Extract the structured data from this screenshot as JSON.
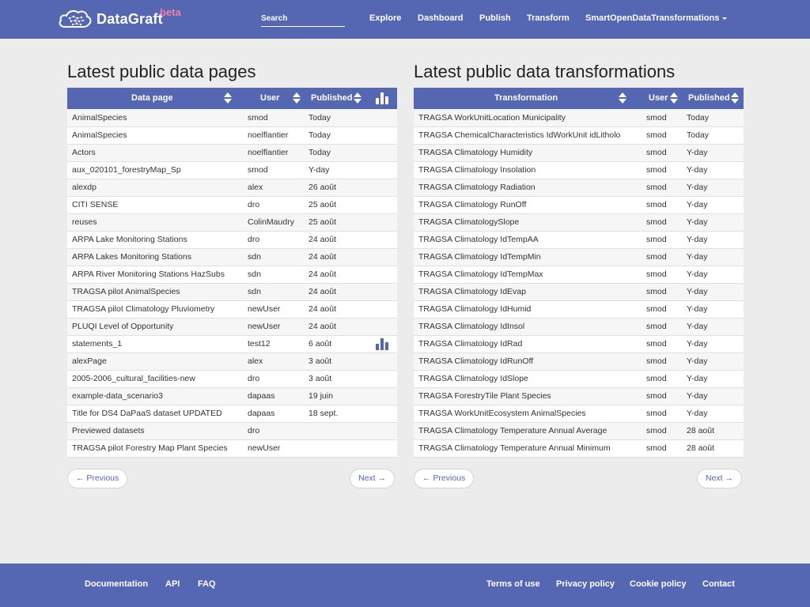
{
  "navbar": {
    "brand": "DataGraft",
    "beta": "beta",
    "search_placeholder": "Search",
    "items": [
      "Explore",
      "Dashboard",
      "Publish",
      "Transform",
      "SmartOpenDataTransformations"
    ]
  },
  "colors": {
    "primary": "#5566b2",
    "beta": "#f37fa8",
    "background": "#ececec"
  },
  "data_pages": {
    "title": "Latest public data pages",
    "columns": [
      "Data page",
      "User",
      "Published"
    ],
    "rows": [
      {
        "name": "AnimalSpecies",
        "user": "smod",
        "published": "Today",
        "chart": false
      },
      {
        "name": "AnimalSpecies",
        "user": "noelflantier",
        "published": "Today",
        "chart": false
      },
      {
        "name": "Actors",
        "user": "noelflantier",
        "published": "Today",
        "chart": false
      },
      {
        "name": "aux_020101_forestryMap_Sp",
        "user": "smod",
        "published": "Y-day",
        "chart": false
      },
      {
        "name": "alexdp",
        "user": "alex",
        "published": "26 août",
        "chart": false
      },
      {
        "name": "CITI SENSE",
        "user": "dro",
        "published": "25 août",
        "chart": false
      },
      {
        "name": "reuses",
        "user": "ColinMaudry",
        "published": "25 août",
        "chart": false
      },
      {
        "name": "ARPA Lake Monitoring Stations",
        "user": "dro",
        "published": "24 août",
        "chart": false
      },
      {
        "name": "ARPA Lakes Monitoring Stations",
        "user": "sdn",
        "published": "24 août",
        "chart": false
      },
      {
        "name": "ARPA River Monitoring Stations HazSubs",
        "user": "sdn",
        "published": "24 août",
        "chart": false
      },
      {
        "name": "TRAGSA pilot AnimalSpecies",
        "user": "sdn",
        "published": "24 août",
        "chart": false
      },
      {
        "name": "TRAGSA pilot Climatology Pluviometry",
        "user": "newUser",
        "published": "24 août",
        "chart": false
      },
      {
        "name": "PLUQI Level of Opportunity",
        "user": "newUser",
        "published": "24 août",
        "chart": false
      },
      {
        "name": "statements_1",
        "user": "test12",
        "published": "6 août",
        "chart": true
      },
      {
        "name": "alexPage",
        "user": "alex",
        "published": "3 août",
        "chart": false
      },
      {
        "name": "2005-2006_cultural_facilities-new",
        "user": "dro",
        "published": "3 août",
        "chart": false
      },
      {
        "name": "example-data_scenario3",
        "user": "dapaas",
        "published": "19 juin",
        "chart": false
      },
      {
        "name": "Title for DS4 DaPaaS dataset UPDATED",
        "user": "dapaas",
        "published": "18 sept.",
        "chart": false
      },
      {
        "name": "Previewed datasets",
        "user": "dro",
        "published": "",
        "chart": false
      },
      {
        "name": "TRAGSA pilot Forestry Map Plant Species",
        "user": "newUser",
        "published": "",
        "chart": false
      }
    ],
    "prev": "← Previous",
    "next": "Next →"
  },
  "transformations": {
    "title": "Latest public data transformations",
    "columns": [
      "Transformation",
      "User",
      "Published"
    ],
    "rows": [
      {
        "name": "TRAGSA WorkUnitLocation Municipality",
        "user": "smod",
        "published": "Today"
      },
      {
        "name": "TRAGSA ChemicalCharacteristics IdWorkUnit idLitholo",
        "user": "smod",
        "published": "Today"
      },
      {
        "name": "TRAGSA Climatology Humidity",
        "user": "smod",
        "published": "Y-day"
      },
      {
        "name": "TRAGSA Climatology Insolation",
        "user": "smod",
        "published": "Y-day"
      },
      {
        "name": "TRAGSA Climatology Radiation",
        "user": "smod",
        "published": "Y-day"
      },
      {
        "name": "TRAGSA Climatology RunOff",
        "user": "smod",
        "published": "Y-day"
      },
      {
        "name": "TRAGSA ClimatologySlope",
        "user": "smod",
        "published": "Y-day"
      },
      {
        "name": "TRAGSA Climatology IdTempAA",
        "user": "smod",
        "published": "Y-day"
      },
      {
        "name": "TRAGSA Climatology IdTempMin",
        "user": "smod",
        "published": "Y-day"
      },
      {
        "name": "TRAGSA Climatology IdTempMax",
        "user": "smod",
        "published": "Y-day"
      },
      {
        "name": "TRAGSA Climatology IdEvap",
        "user": "smod",
        "published": "Y-day"
      },
      {
        "name": "TRAGSA Climatology IdHumid",
        "user": "smod",
        "published": "Y-day"
      },
      {
        "name": "TRAGSA Climatology IdInsol",
        "user": "smod",
        "published": "Y-day"
      },
      {
        "name": "TRAGSA Climatology IdRad",
        "user": "smod",
        "published": "Y-day"
      },
      {
        "name": "TRAGSA Climatology IdRunOff",
        "user": "smod",
        "published": "Y-day"
      },
      {
        "name": "TRAGSA Climatology IdSlope",
        "user": "smod",
        "published": "Y-day"
      },
      {
        "name": "TRAGSA ForestryTile Plant Species",
        "user": "smod",
        "published": "Y-day"
      },
      {
        "name": "TRAGSA WorkUnitEcosystem AnimalSpecies",
        "user": "smod",
        "published": "Y-day"
      },
      {
        "name": "TRAGSA Climatology Temperature Annual Average",
        "user": "smod",
        "published": "28 août"
      },
      {
        "name": "TRAGSA Climatology Temperature Annual Minimum",
        "user": "smod",
        "published": "28 août"
      }
    ],
    "prev": "← Previous",
    "next": "Next →"
  },
  "footer": {
    "left": [
      "Documentation",
      "API",
      "FAQ"
    ],
    "right": [
      "Terms of use",
      "Privacy policy",
      "Cookie policy",
      "Contact"
    ]
  }
}
